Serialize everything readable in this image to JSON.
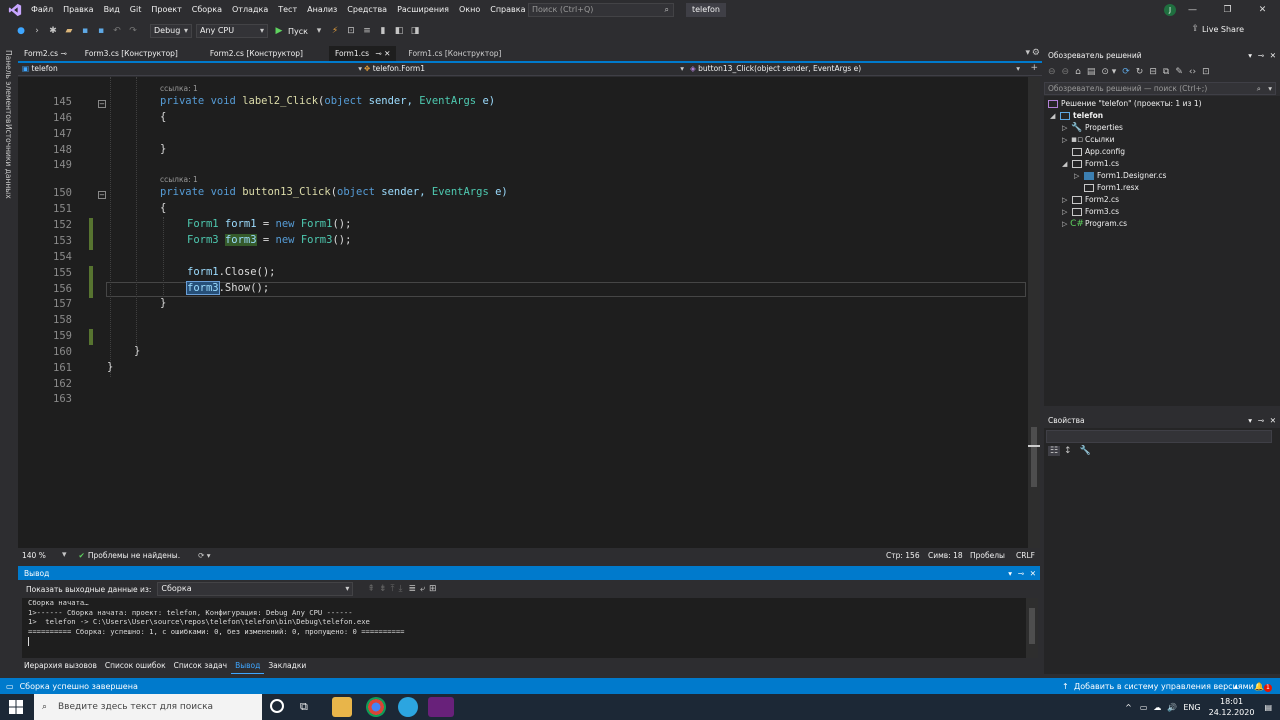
{
  "menubar": {
    "items": [
      "Файл",
      "Правка",
      "Вид",
      "Git",
      "Проект",
      "Сборка",
      "Отладка",
      "Тест",
      "Анализ",
      "Средства",
      "Расширения",
      "Окно",
      "Справка"
    ],
    "search_placeholder": "Поиск (Ctrl+Q)",
    "project_badge": "telefon",
    "avatar_letter": "J"
  },
  "toolbar": {
    "config": "Debug",
    "platform": "Any CPU",
    "run_label": "Пуск",
    "live_share": "Live Share"
  },
  "left_strip": {
    "toolbox": "Панель элементов",
    "datasources": "Источники данных"
  },
  "doc_tabs": [
    "Form2.cs",
    "Form3.cs [Конструктор]",
    "Form2.cs [Конструктор]",
    "Form1.cs",
    "Form1.cs [Конструктор]"
  ],
  "navbar": {
    "project": "telefon",
    "class": "telefon.Form1",
    "member": "button13_Click(object sender, EventArgs e)"
  },
  "editor": {
    "line_numbers": [
      "145",
      "146",
      "147",
      "148",
      "149",
      "150",
      "151",
      "152",
      "153",
      "154",
      "155",
      "156",
      "157",
      "158",
      "159",
      "160",
      "161",
      "162",
      "163"
    ],
    "ref_hint": "ссылка: 1",
    "code": {
      "l145_kw": "private void ",
      "l145_fn": "label2_Click",
      "l145_p1": "(",
      "l145_kw2": "object",
      "l145_pm": " sender, ",
      "l145_ty": "EventArgs",
      "l145_pm2": " e)",
      "brace_open": "{",
      "brace_close": "}",
      "l150_fn": "button13_Click",
      "l152_ty": "Form1",
      "l152_var": " form1 ",
      "l152_eq": "= ",
      "l152_new": "new ",
      "l152_ty2": "Form1",
      "l152_end": "();",
      "l153_ty": "Form3",
      "l153_var": "form3",
      "l153_ty2": "Form3",
      "l155_var": "form1",
      "l155_call": ".Close();",
      "l156_var": "form3",
      "l156_call": ".Show();"
    }
  },
  "editor_status": {
    "zoom": "140 %",
    "issues": "Проблемы не найдены.",
    "line": "Стр: 156",
    "col": "Симв: 18",
    "spaces": "Пробелы",
    "eol": "CRLF"
  },
  "output": {
    "title": "Вывод",
    "show_from_label": "Показать выходные данные из:",
    "source": "Сборка",
    "lines": [
      "Сборка начата…",
      "1>------ Сборка начата: проект: telefon, Конфигурация: Debug Any CPU ------",
      "1>  telefon -> C:\\Users\\User\\source\\repos\\telefon\\telefon\\bin\\Debug\\telefon.exe",
      "========== Сборка: успешно: 1, с ошибками: 0, без изменений: 0, пропущено: 0 =========="
    ]
  },
  "bottom_tabs": [
    "Иерархия вызовов",
    "Список ошибок",
    "Список задач",
    "Вывод",
    "Закладки"
  ],
  "solution_explorer": {
    "title": "Обозреватель решений",
    "search_placeholder": "Обозреватель решений — поиск (Ctrl+;)",
    "solution": "Решение \"telefon\" (проекты: 1 из 1)",
    "project": "telefon",
    "items": [
      "Properties",
      "Ссылки",
      "App.config",
      "Form1.cs",
      "Form1.Designer.cs",
      "Form1.resx",
      "Form2.cs",
      "Form3.cs",
      "Program.cs"
    ]
  },
  "properties": {
    "title": "Свойства"
  },
  "status_bar": {
    "message": "Сборка успешно завершена",
    "vcs": "Добавить в систему управления версиями",
    "notif_count": "1"
  },
  "taskbar": {
    "search_placeholder": "Введите здесь текст для поиска",
    "lang": "ENG",
    "time": "18:01",
    "date": "24.12.2020"
  },
  "colors": {
    "accent": "#007acc",
    "editor_bg": "#1e1e1e",
    "keyword": "#569cd6",
    "type": "#4ec9b0",
    "method": "#dcdcaa"
  }
}
